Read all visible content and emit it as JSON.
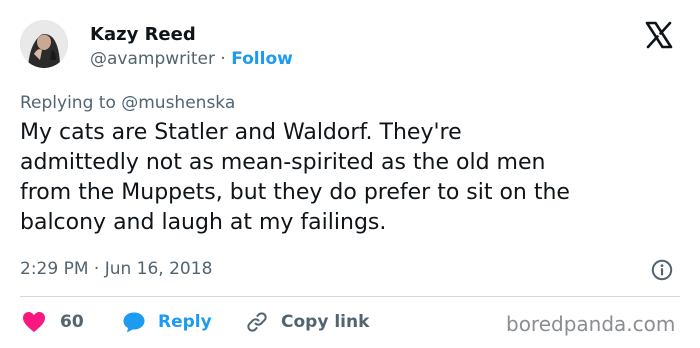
{
  "author": {
    "display_name": "Kazy Reed",
    "handle": "@avampwriter",
    "separator": "·",
    "follow_label": "Follow"
  },
  "platform_logo": "x-logo-icon",
  "reply_context": "Replying to @mushenska",
  "tweet": {
    "lines": [
      "My cats are Statler and Waldorf. They're",
      "admittedly not as mean-spirited as the old men",
      "from the Muppets, but they do prefer to sit on the",
      "balcony and laugh at my failings."
    ],
    "timestamp": "2:29 PM · Jun 16, 2018"
  },
  "actions": {
    "likes_count": "60",
    "reply_label": "Reply",
    "copy_link_label": "Copy link"
  },
  "watermark": "boredpanda.com",
  "colors": {
    "accent": "#1d9bf0",
    "heart": "#f91880",
    "text_primary": "#0f1419",
    "text_secondary": "#536471",
    "divider": "#cfd9de"
  }
}
